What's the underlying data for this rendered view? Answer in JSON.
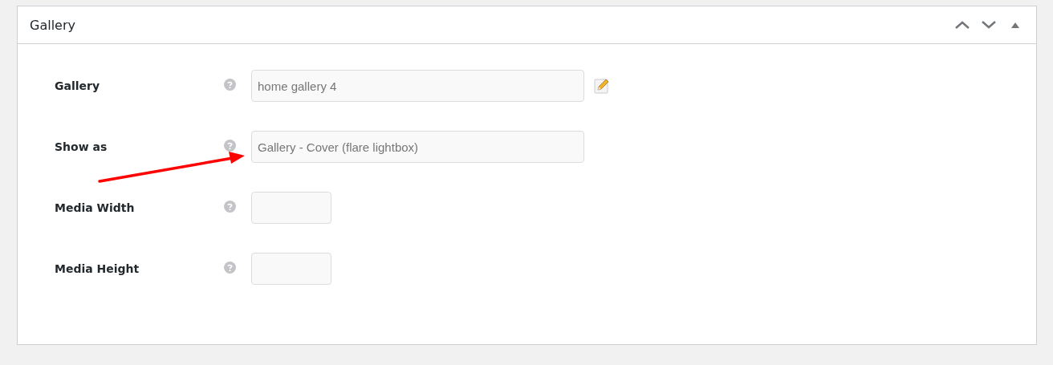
{
  "panel": {
    "title": "Gallery",
    "header_buttons": [
      {
        "kind": "up"
      },
      {
        "kind": "down"
      },
      {
        "kind": "toggle"
      }
    ]
  },
  "fields": [
    {
      "label": "Gallery",
      "kind": "wide",
      "value": "home gallery 4",
      "edit_button": true
    },
    {
      "label": "Show as",
      "kind": "wide",
      "value": "Gallery - Cover (flare lightbox)",
      "edit_button": false
    },
    {
      "label": "Media Width",
      "kind": "narrow",
      "edit_button": false
    },
    {
      "label": "Media Height",
      "kind": "narrow",
      "edit_button": false
    }
  ],
  "annotation": {
    "kind": "arrow"
  }
}
